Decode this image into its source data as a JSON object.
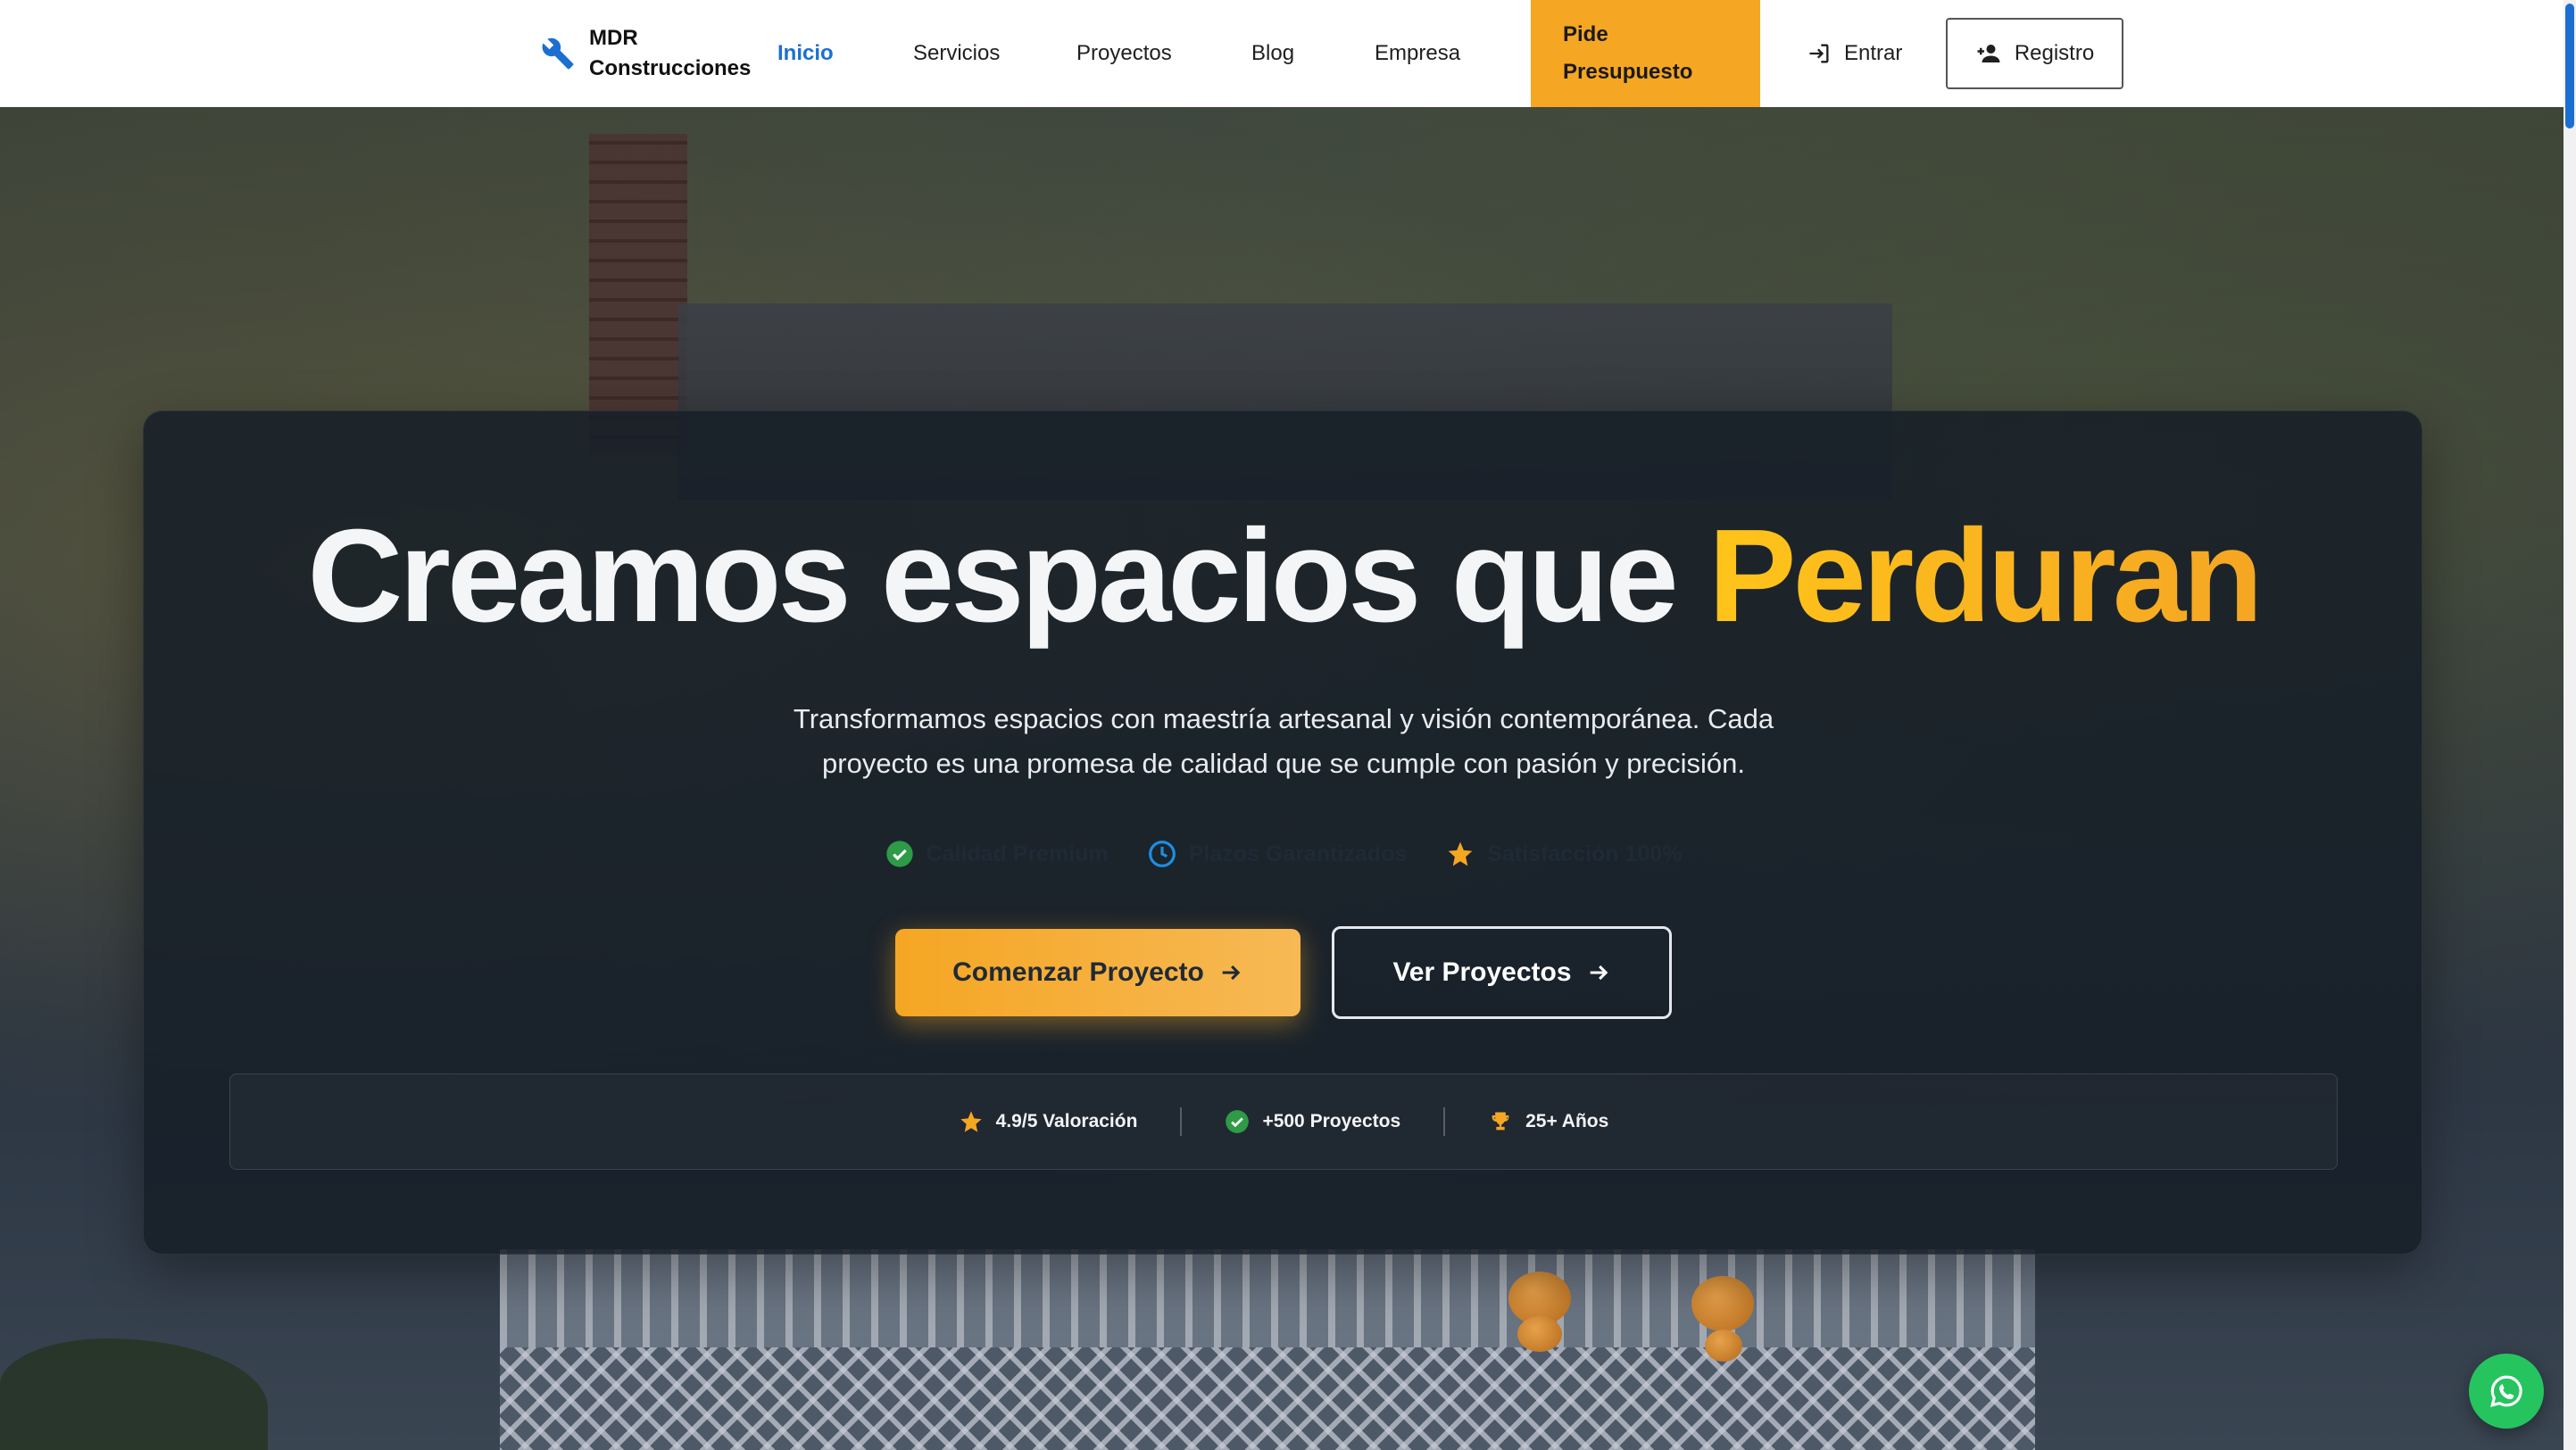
{
  "navbar": {
    "brand_line1": "MDR",
    "brand_line2": "Construcciones",
    "brand_icon": "wrench-icon",
    "links": [
      {
        "label": "Inicio",
        "active": true
      },
      {
        "label": "Servicios",
        "active": false
      },
      {
        "label": "Proyectos",
        "active": false
      },
      {
        "label": "Blog",
        "active": false
      },
      {
        "label": "Empresa",
        "active": false
      }
    ],
    "quote_line1": "Pide",
    "quote_line2": "Presupuesto",
    "login_label": "Entrar",
    "register_label": "Registro"
  },
  "hero": {
    "title_parts": [
      "Creamos",
      "espacios",
      "que"
    ],
    "title_accent": "Perduran",
    "subtitle_line1": "Transformamos espacios con maestría artesanal y visión contemporánea. Cada",
    "subtitle_line2": "proyecto es una promesa de calidad que se cumple con pasión y precisión.",
    "features": [
      {
        "label": "Calidad Premium",
        "icon": "check-circle-icon"
      },
      {
        "label": "Plazos Garantizados",
        "icon": "clock-icon"
      },
      {
        "label": "Satisfacción 100%",
        "icon": "star-icon"
      }
    ],
    "primary_button": "Comenzar Proyecto",
    "secondary_button": "Ver Proyectos",
    "stats": [
      {
        "label": "4.9/5 Valoración",
        "icon": "star-icon"
      },
      {
        "label": "+500 Proyectos",
        "icon": "check-circle-icon"
      },
      {
        "label": "25+ Años",
        "icon": "trophy-icon"
      }
    ]
  },
  "colors": {
    "accent": "#f5a623",
    "nav_active": "#1c6fd1",
    "whatsapp": "#25c45f"
  },
  "floating": {
    "whatsapp_icon": "whatsapp-icon"
  }
}
